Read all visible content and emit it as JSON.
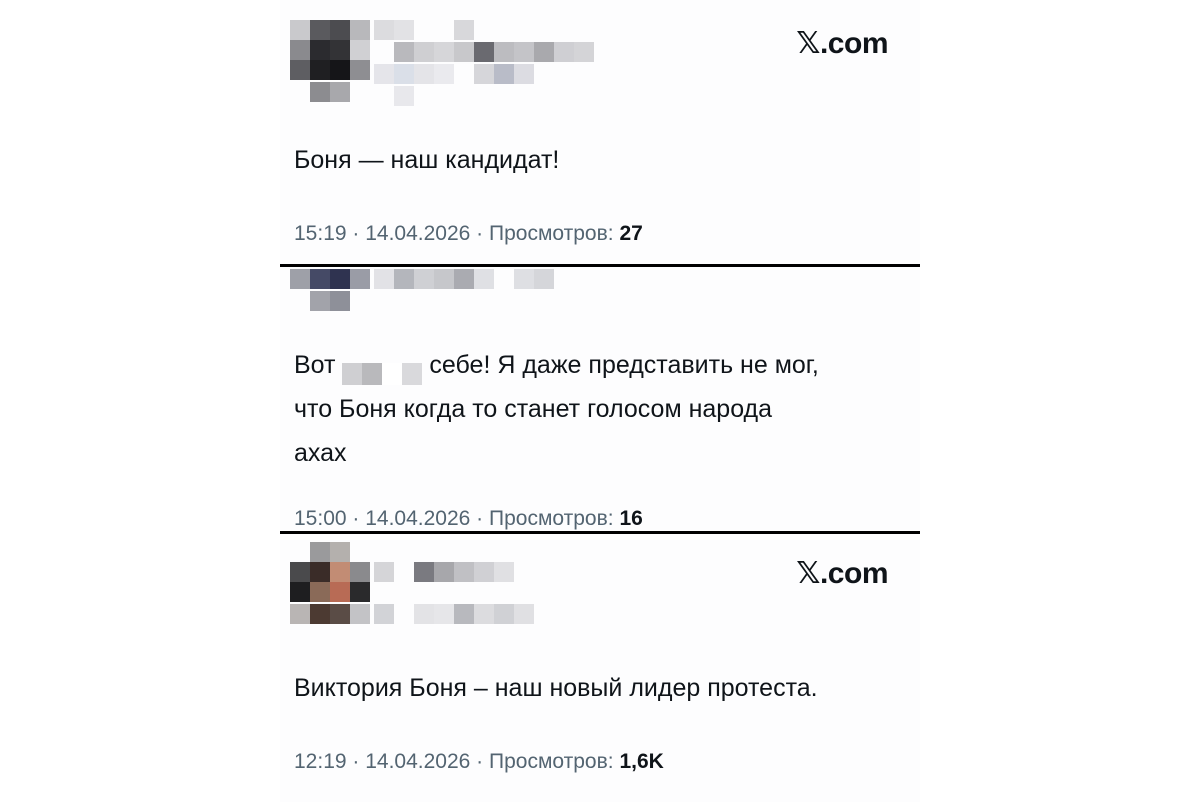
{
  "posts": [
    {
      "brand": ".com",
      "text": "Боня — наш кандидат!",
      "time": "15:19",
      "date": "14.04.2026",
      "views_label": "Просмотров:",
      "views": "27"
    },
    {
      "text_before": "Вот",
      "text_after": "себе! Я даже представить не мог,",
      "text_line2": "что Боня когда то станет голосом народа",
      "text_line3": "ахах",
      "time": "15:00",
      "date": "14.04.2026",
      "views_label": "Просмотров:",
      "views": "16"
    },
    {
      "brand": ".com",
      "text": "Виктория Боня – наш новый лидер протеста.",
      "time": "12:19",
      "date": "14.04.2026",
      "views_label": "Просмотров:",
      "views": "1,6K"
    }
  ],
  "separator": " · ",
  "icons": {
    "brand": "x-logo-icon"
  }
}
